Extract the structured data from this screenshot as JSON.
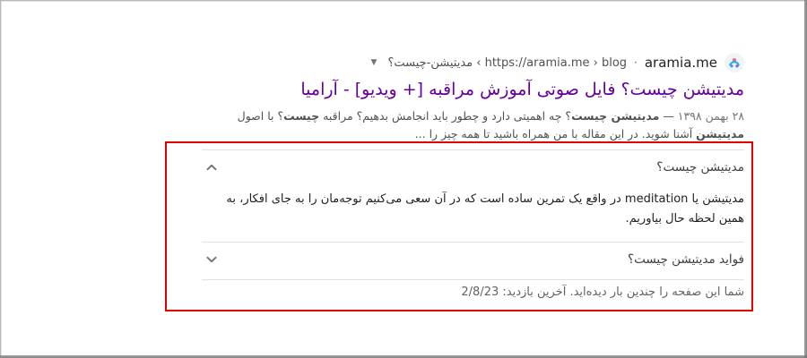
{
  "result": {
    "site": {
      "name": "aramia.me",
      "breadcrumb": "https://aramia.me › blog › مدیتیشن-چیست؟",
      "favicon_icon": "aramia-logo-icon",
      "menu_icon": "triangle-down-icon"
    },
    "title": "مدیتیشن چیست؟ فایل صوتی آموزش مراقبه [+ ویدیو] - آرامیا",
    "snippet": {
      "date": "۲۸ بهمن ۱۳۹۸",
      "dash": " — ",
      "line1_part1": "مدیتیشن چیست",
      "line1_part2": "؟ چه اهمیتی دارد و چطور باید انجامش بدهیم؟ مراقبه ",
      "line1_part3": "چیست",
      "line1_part4": "؟ با اصول ",
      "line1_part5": "مدیتیشن",
      "line1_part6": " آشنا شوید. در این مقاله با من همراه باشید تا همه چیز را ..."
    }
  },
  "faq": {
    "items": [
      {
        "question": "مدیتیشن چیست؟",
        "expanded": true,
        "answer": "مدیتیشن یا meditation در واقع یک تمرین ساده است که در آن سعی می‌کنیم توجه‌مان را به جای افکار، به همین لحظه حال بیاوریم.",
        "chevron_icon": "chevron-up-icon"
      },
      {
        "question": "فواید مدیتیشن چیست؟",
        "expanded": false,
        "chevron_icon": "chevron-down-icon"
      }
    ]
  },
  "visited": {
    "text": "شما این صفحه را چندین بار دیده‌اید. آخرین بازدید: 2/8/23"
  },
  "colors": {
    "highlight_border": "#e00000",
    "visited_title": "#660099"
  }
}
